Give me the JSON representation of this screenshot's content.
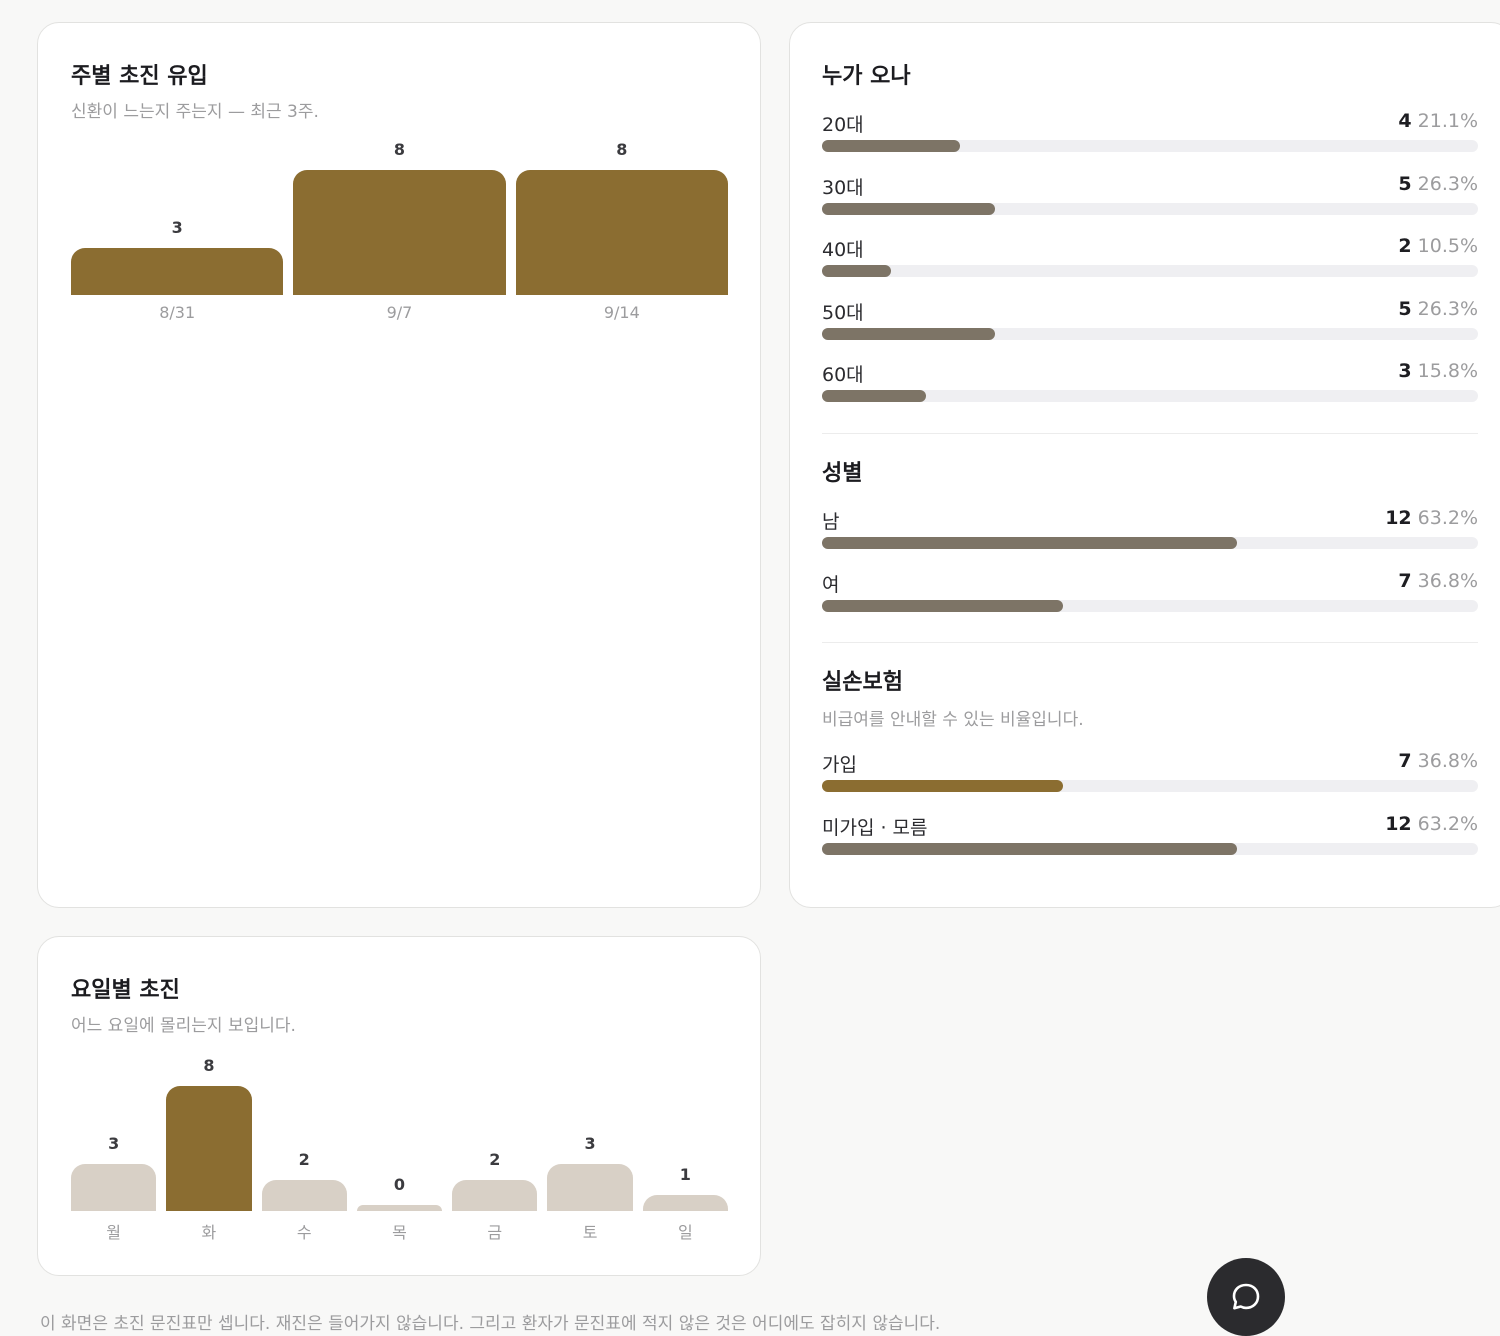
{
  "weekly": {
    "title": "주별 초진 유입",
    "subtitle": "신환이 느는지 주는지 — 최근 3주.",
    "chart_data": {
      "type": "bar",
      "categories": [
        "8/31",
        "9/7",
        "9/14"
      ],
      "values": [
        3,
        8,
        8
      ],
      "value_labels": [
        "3",
        "8",
        "8"
      ],
      "color": "#8b6d31"
    }
  },
  "who": {
    "title": "누가 오나",
    "age": [
      {
        "label": "20대",
        "count": "4",
        "pct": "21.1%",
        "ratio": 0.211
      },
      {
        "label": "30대",
        "count": "5",
        "pct": "26.3%",
        "ratio": 0.263
      },
      {
        "label": "40대",
        "count": "2",
        "pct": "10.5%",
        "ratio": 0.105
      },
      {
        "label": "50대",
        "count": "5",
        "pct": "26.3%",
        "ratio": 0.263
      },
      {
        "label": "60대",
        "count": "3",
        "pct": "15.8%",
        "ratio": 0.158
      }
    ],
    "gender_title": "성별",
    "gender": [
      {
        "label": "남",
        "count": "12",
        "pct": "63.2%",
        "ratio": 0.632
      },
      {
        "label": "여",
        "count": "7",
        "pct": "36.8%",
        "ratio": 0.368
      }
    ],
    "insurance_title": "실손보험",
    "insurance_subtitle": "비급여를 안내할 수 있는 비율입니다.",
    "insurance": [
      {
        "label": "가입",
        "count": "7",
        "pct": "36.8%",
        "ratio": 0.368,
        "highlight": true
      },
      {
        "label": "미가입 · 모름",
        "count": "12",
        "pct": "63.2%",
        "ratio": 0.632,
        "highlight": false
      }
    ],
    "bar_color": "#7d7466",
    "highlight_color": "#8b6d31",
    "track_color": "#efeff2"
  },
  "weekday": {
    "title": "요일별 초진",
    "subtitle": "어느 요일에 몰리는지 보입니다.",
    "chart_data": {
      "type": "bar",
      "categories": [
        "월",
        "화",
        "수",
        "목",
        "금",
        "토",
        "일"
      ],
      "values": [
        3,
        8,
        2,
        0,
        2,
        3,
        1
      ],
      "value_labels": [
        "3",
        "8",
        "2",
        "0",
        "2",
        "3",
        "1"
      ],
      "highlight_index": 1,
      "color": "#d8d0c6",
      "highlight_color": "#8b6d31"
    }
  },
  "footer": {
    "text": "이 화면은 초진 문진표만 셉니다. 재진은 들어가지 않습니다. 그리고 환자가 문진표에 적지 않은 것은 어디에도 잡히지 않습니다."
  },
  "chat": {
    "icon": "chat-bubble-icon"
  }
}
